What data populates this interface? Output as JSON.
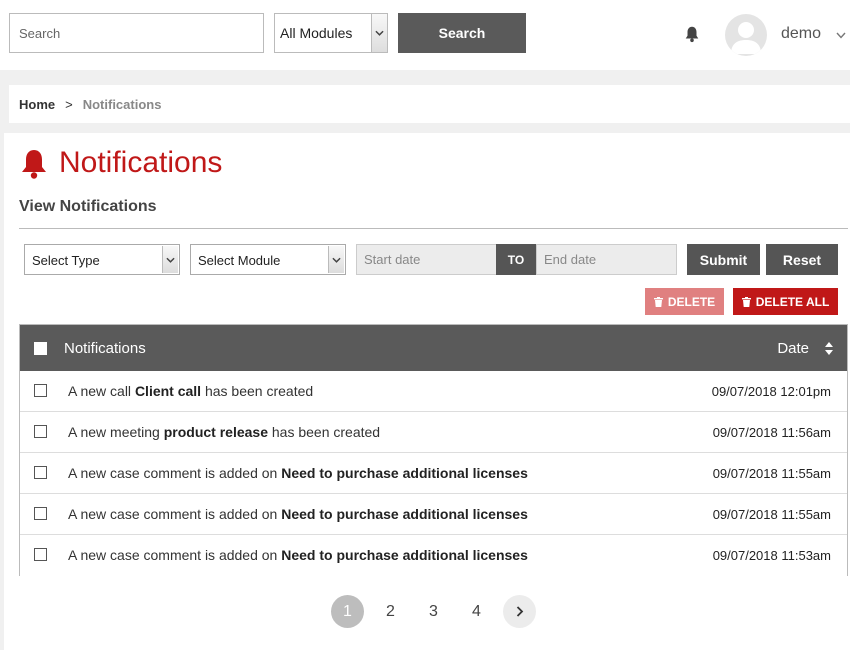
{
  "header": {
    "search_placeholder": "Search",
    "module_select": "All Modules",
    "search_button": "Search",
    "username": "demo"
  },
  "breadcrumb": {
    "home": "Home",
    "separator": ">",
    "current": "Notifications"
  },
  "page": {
    "title": "Notifications",
    "subtitle": "View Notifications",
    "accent_color": "#c01818"
  },
  "filters": {
    "type_select": "Select Type",
    "module_select": "Select Module",
    "start_date_placeholder": "Start date",
    "to_label": "TO",
    "end_date_placeholder": "End date",
    "submit": "Submit",
    "reset": "Reset"
  },
  "actions": {
    "delete": "DELETE",
    "delete_all": "DELETE ALL"
  },
  "table": {
    "col_notifications": "Notifications",
    "col_date": "Date",
    "rows": [
      {
        "prefix": "A new call ",
        "subject": "Client call",
        "suffix": " has been created",
        "date": "09/07/2018 12:01pm"
      },
      {
        "prefix": "A new meeting ",
        "subject": "product release",
        "suffix": " has been created",
        "date": "09/07/2018 11:56am"
      },
      {
        "prefix": "A new case comment is added on ",
        "subject": "Need to purchase additional licenses",
        "suffix": "",
        "date": "09/07/2018 11:55am"
      },
      {
        "prefix": "A new case comment is added on ",
        "subject": "Need to purchase additional licenses",
        "suffix": "",
        "date": "09/07/2018 11:55am"
      },
      {
        "prefix": "A new case comment is added on ",
        "subject": "Need to purchase additional licenses",
        "suffix": "",
        "date": "09/07/2018 11:53am"
      }
    ]
  },
  "pagination": {
    "pages": [
      "1",
      "2",
      "3",
      "4"
    ],
    "current": "1",
    "next_icon": "chevron-right-icon"
  }
}
